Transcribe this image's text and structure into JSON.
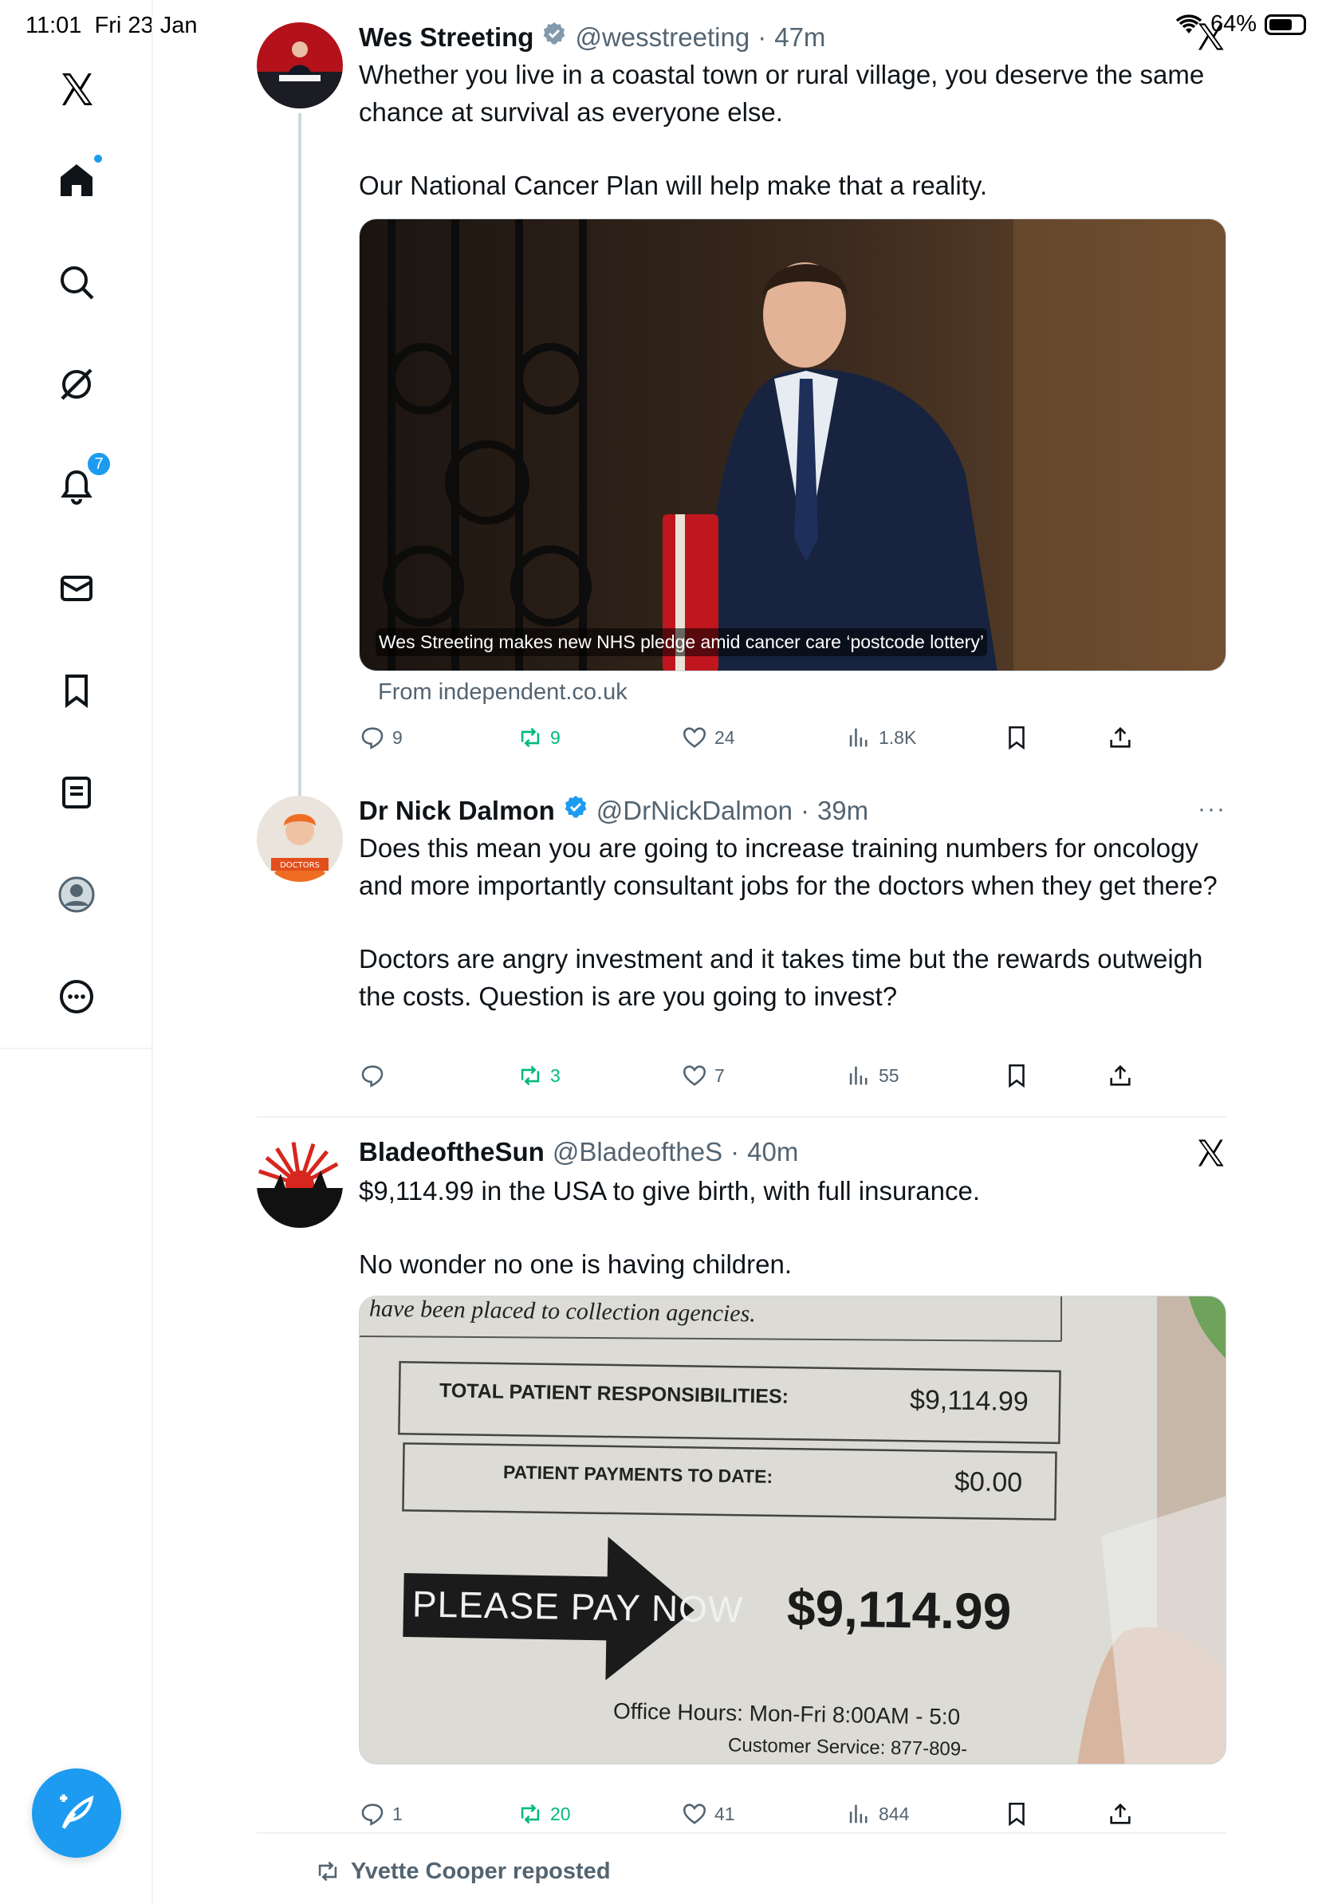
{
  "status_bar": {
    "time": "11:01",
    "date": "Fri 23 Jan",
    "battery": "64%"
  },
  "sidebar": {
    "notifications_badge": "7",
    "items": [
      "x-logo",
      "home",
      "search",
      "grok",
      "notifications",
      "messages",
      "bookmarks",
      "lists",
      "profile",
      "more"
    ]
  },
  "tweets": [
    {
      "name": "Wes Streeting",
      "handle": "@wesstreeting",
      "time": "47m",
      "text": [
        "Whether you live in a coastal town or rural village, you deserve the same chance at survival as everyone else.",
        "Our National Cancer Plan will help make that a reality."
      ],
      "media_caption": "Wes Streeting makes new NHS pledge amid cancer care ‘postcode lottery’",
      "link_source": "From independent.co.uk",
      "replies": "9",
      "reposts": "9",
      "likes": "24",
      "views": "1.8K"
    },
    {
      "name": "Dr Nick Dalmon",
      "handle": "@DrNickDalmon",
      "time": "39m",
      "avatar_text": "DOCTORS",
      "text": [
        "Does this mean you are going to increase training numbers for oncology and more importantly consultant jobs for the doctors when they get there?",
        "Doctors are angry investment and it takes time but the rewards outweigh the costs. Question is are you going to invest?"
      ],
      "replies": "",
      "reposts": "3",
      "likes": "7",
      "views": "55"
    },
    {
      "name": "BladeoftheSun",
      "handle": "@BladeoftheS",
      "time": "40m",
      "text": [
        "$9,114.99 in the USA to give birth, with full insurance.",
        "No wonder no one is having children."
      ],
      "bill": {
        "top_line": "have been placed to collection agencies.",
        "total_label": "TOTAL PATIENT RESPONSIBILITIES:",
        "total_value": "$9,114.99",
        "paid_label": "PATIENT PAYMENTS TO DATE:",
        "paid_value": "$0.00",
        "pay_now": "PLEASE PAY NOW",
        "pay_amount": "$9,114.99",
        "hours": "Office Hours: Mon-Fri 8:00AM - 5:0",
        "service": "Customer Service: 877-809-"
      },
      "replies": "1",
      "reposts": "20",
      "likes": "41",
      "views": "844"
    }
  ],
  "repost_notice": "Yvette Cooper reposted",
  "separator": "·"
}
